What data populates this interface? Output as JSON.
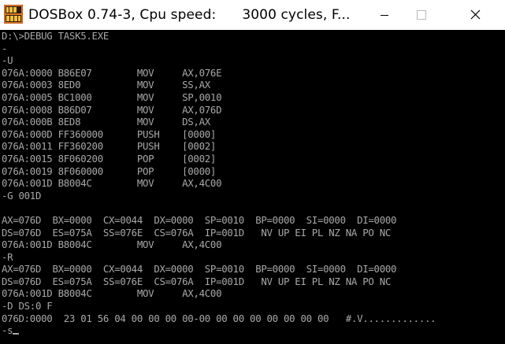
{
  "window": {
    "title": "DOSBox 0.74-3, Cpu speed:      3000 cycles, F...",
    "icon": "dosbox-icon",
    "controls": [
      "minimize-icon",
      "maximize-icon",
      "close-icon"
    ]
  },
  "console": {
    "lines": [
      "D:\\>DEBUG TASK5.EXE",
      "-",
      "-U",
      "076A:0000 B86E07        MOV     AX,076E",
      "076A:0003 8ED0          MOV     SS,AX",
      "076A:0005 BC1000        MOV     SP,0010",
      "076A:0008 B86D07        MOV     AX,076D",
      "076A:000B 8ED8          MOV     DS,AX",
      "076A:000D FF360000      PUSH    [0000]",
      "076A:0011 FF360200      PUSH    [0002]",
      "076A:0015 8F060200      POP     [0002]",
      "076A:0019 8F060000      POP     [0000]",
      "076A:001D B8004C        MOV     AX,4C00",
      "-G 001D",
      "",
      "AX=076D  BX=0000  CX=0044  DX=0000  SP=0010  BP=0000  SI=0000  DI=0000",
      "DS=076D  ES=075A  SS=076E  CS=076A  IP=001D   NV UP EI PL NZ NA PO NC",
      "076A:001D B8004C        MOV     AX,4C00",
      "-R",
      "AX=076D  BX=0000  CX=0044  DX=0000  SP=0010  BP=0000  SI=0000  DI=0000",
      "DS=076D  ES=075A  SS=076E  CS=076A  IP=001D   NV UP EI PL NZ NA PO NC",
      "076A:001D B8004C        MOV     AX,4C00",
      "-D DS:0 F",
      "076D:0000  23 01 56 04 00 00 00 00-00 00 00 00 00 00 00 00   #.V.............",
      "-s"
    ],
    "text_color": "#a8a8a8",
    "background": "#000000"
  }
}
